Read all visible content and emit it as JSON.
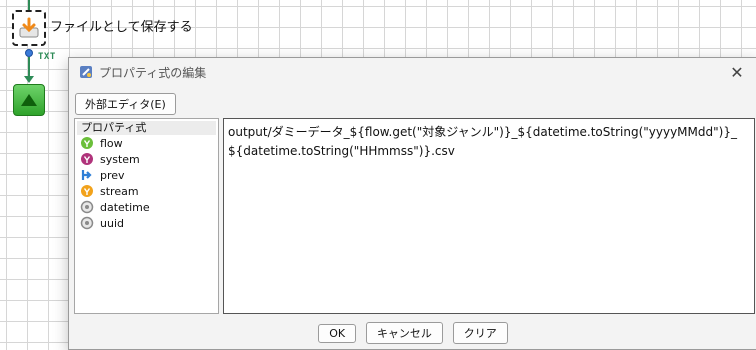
{
  "canvas": {
    "node_label": "ファイルとして保存する",
    "connector_tag": "TXT"
  },
  "dialog": {
    "title": "プロパティ式の編集",
    "close_glyph": "✕",
    "external_editor_label": "外部エディタ(E)",
    "tree_header": "プロパティ式",
    "tree_items": [
      {
        "label": "flow",
        "icon": "flow-icon",
        "color": "#6bbf3a"
      },
      {
        "label": "system",
        "icon": "system-icon",
        "color": "#b0337b"
      },
      {
        "label": "prev",
        "icon": "prev-icon",
        "color": "#2f7fd6"
      },
      {
        "label": "stream",
        "icon": "stream-icon",
        "color": "#f2a21b"
      },
      {
        "label": "datetime",
        "icon": "datetime-icon",
        "color": "#8a8a8a"
      },
      {
        "label": "uuid",
        "icon": "uuid-icon",
        "color": "#8a8a8a"
      }
    ],
    "expression": "output/ダミーデータ_${flow.get(\"対象ジャンル\")}_${datetime.toString(\"yyyyMMdd\")}_${datetime.toString(\"HHmmss\")}.csv",
    "buttons": {
      "ok": "OK",
      "cancel": "キャンセル",
      "clear": "クリア"
    }
  }
}
